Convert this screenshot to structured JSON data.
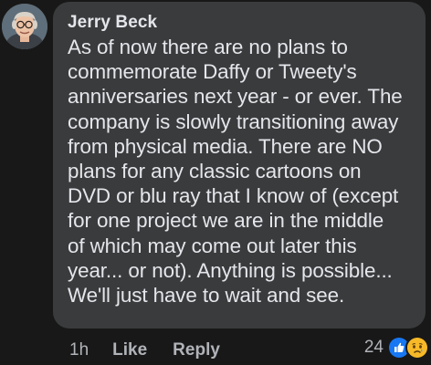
{
  "comment": {
    "author": "Jerry Beck",
    "text": "As of now there are no plans to\ncommemorate Daffy or Tweety's\nanniversaries next year - or ever. The\ncompany is slowly transitioning away\nfrom physical media. There are NO\nplans for any classic cartoons on\nDVD or blu ray that I know of (except\nfor one project we are in the middle\nof which may come out later this\nyear... or not). Anything is possible...\nWe'll just have to wait and see."
  },
  "actions": {
    "time": "1h",
    "like_label": "Like",
    "reply_label": "Reply"
  },
  "reactions": {
    "count": "24",
    "icons": [
      "like-reaction-icon",
      "sad-reaction-icon"
    ],
    "colors": {
      "like": "#1877f2",
      "sad": "#f7b928"
    }
  },
  "colors": {
    "background": "#181818",
    "bubble": "#3a3b3c",
    "text": "#e4e6eb",
    "secondary_text": "#b0b3b8"
  }
}
